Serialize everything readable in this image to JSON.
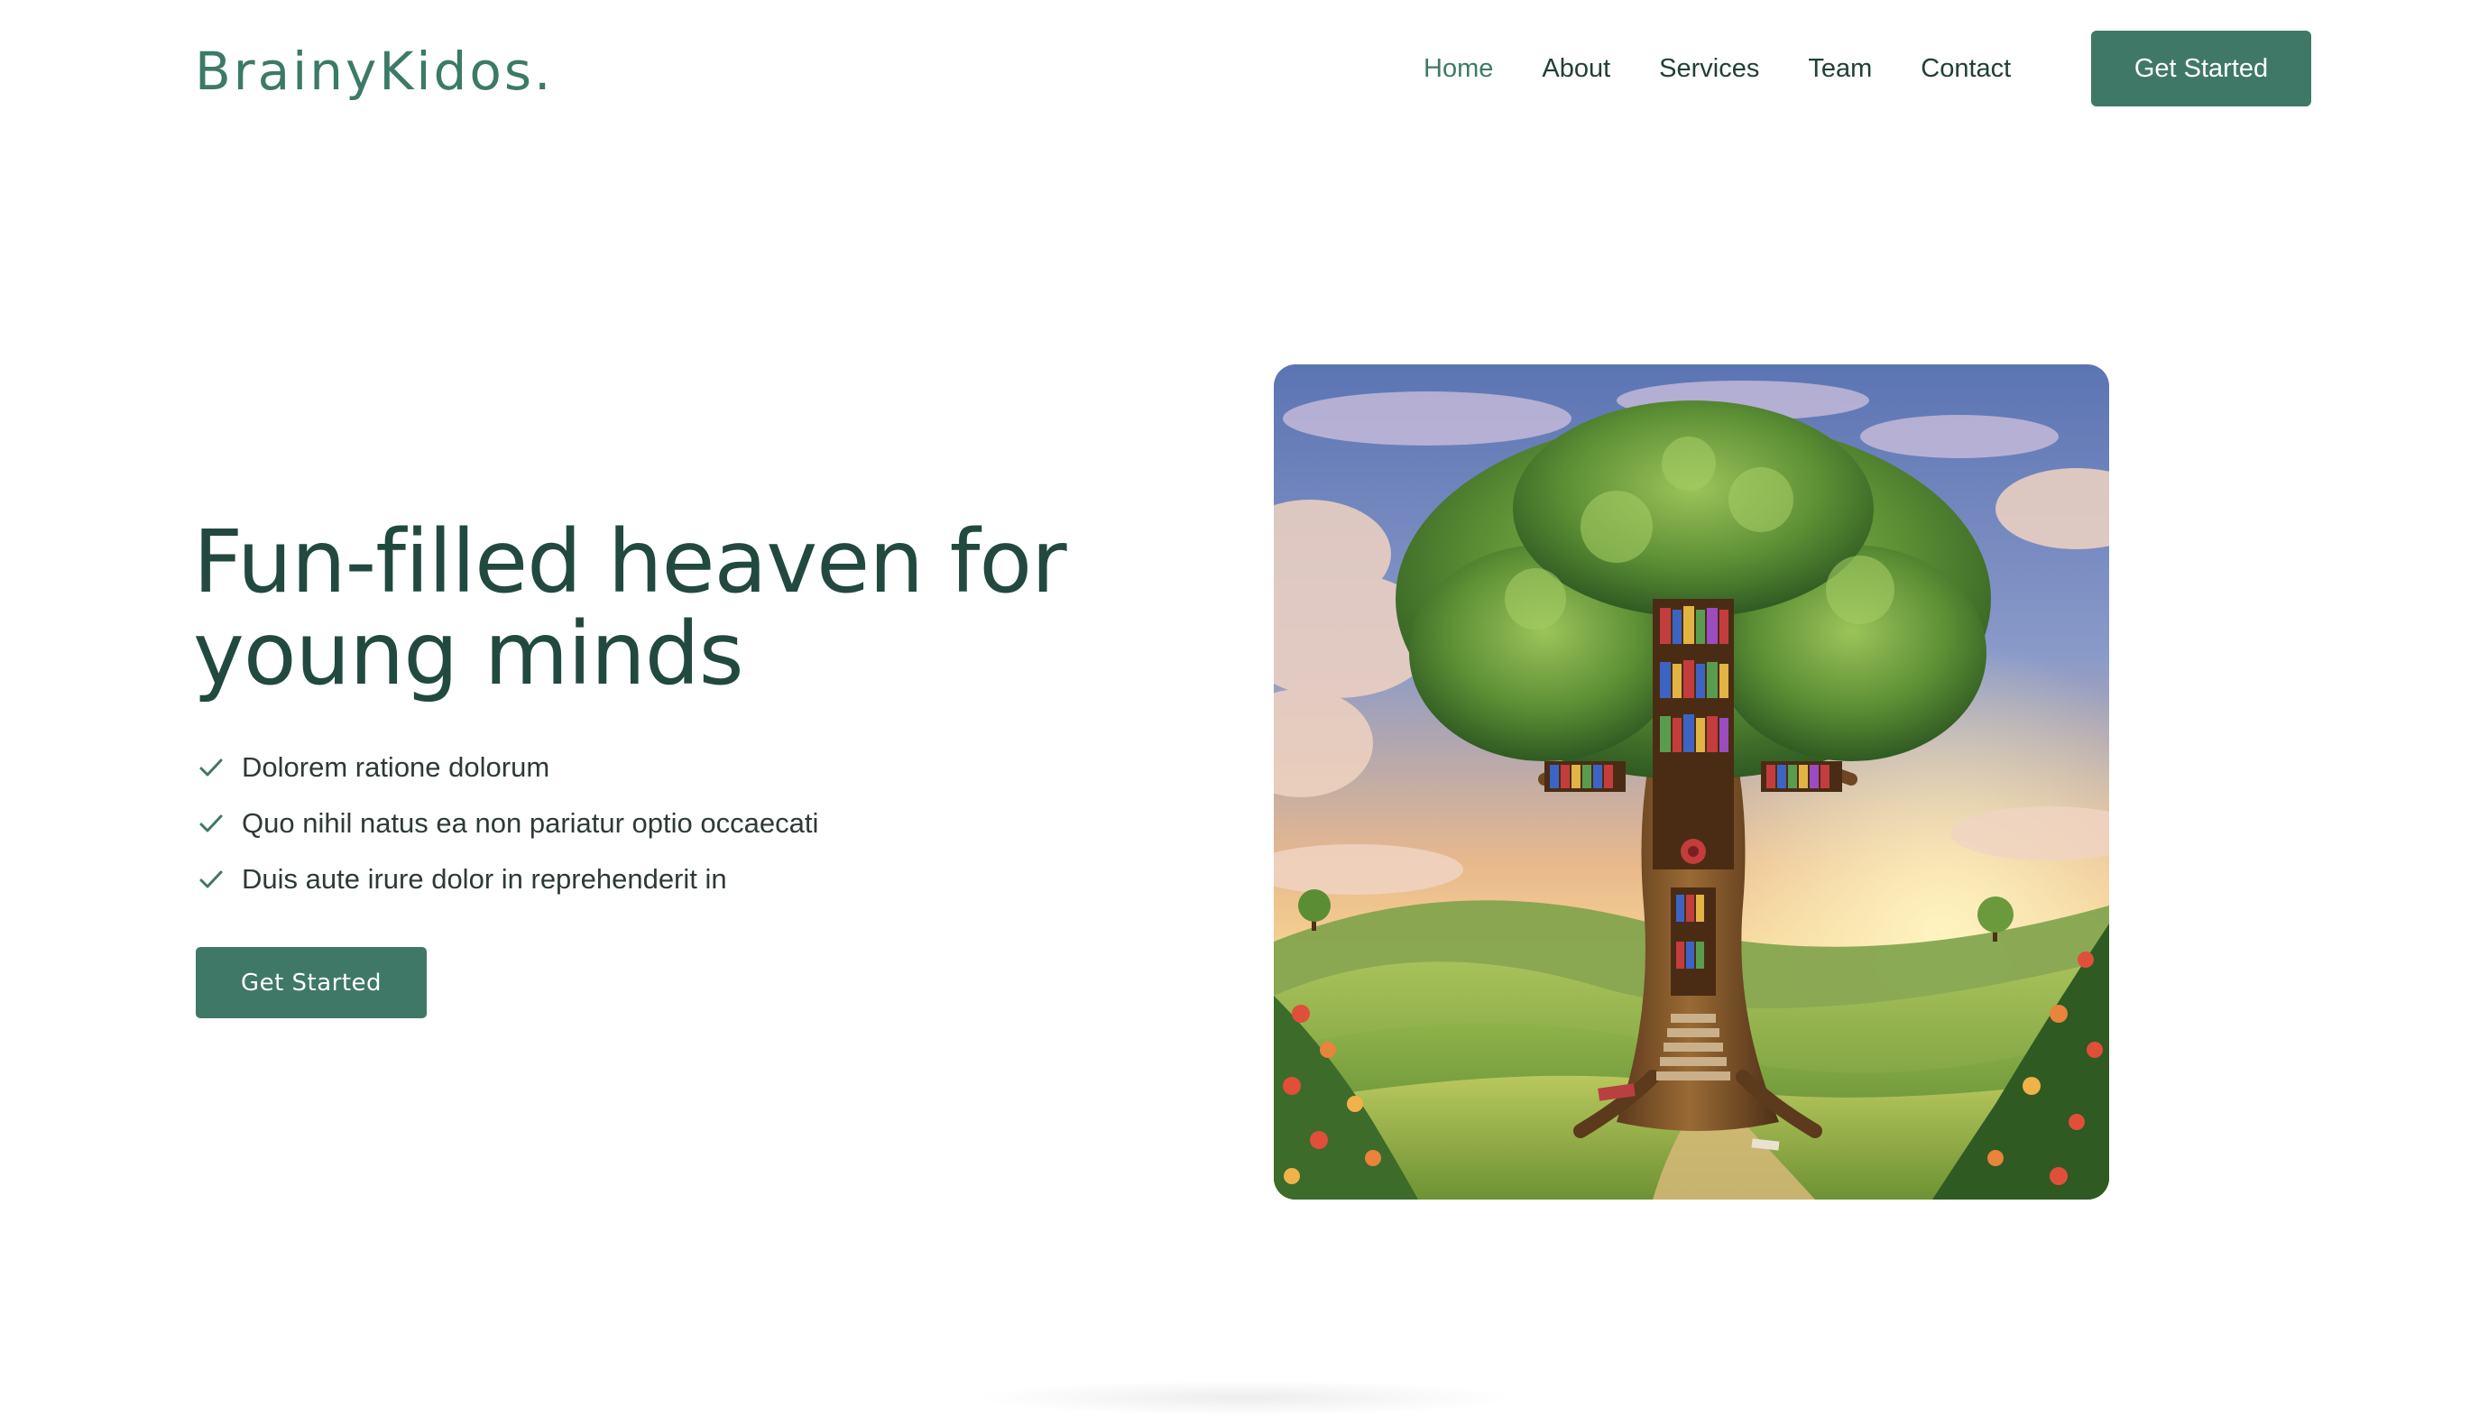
{
  "brand": {
    "logo_text": "BrainyKidos.",
    "accent_color": "#3f7867",
    "heading_color": "#22493f"
  },
  "nav": {
    "items": [
      {
        "label": "Home",
        "active": true
      },
      {
        "label": "About",
        "active": false
      },
      {
        "label": "Services",
        "active": false
      },
      {
        "label": "Team",
        "active": false
      },
      {
        "label": "Contact",
        "active": false
      }
    ],
    "cta_label": "Get Started"
  },
  "hero": {
    "title_line1": "Fun-filled heaven for",
    "title_line2": "young minds",
    "features": [
      "Dolorem ratione dolorum",
      "Quo nihil natus ea non pariatur optio occaecati",
      "Duis aute irure dolor in reprehenderit in"
    ],
    "feature_icon": "check-icon",
    "cta_label": "Get Started",
    "image_subject": "illustration-tree-library"
  }
}
